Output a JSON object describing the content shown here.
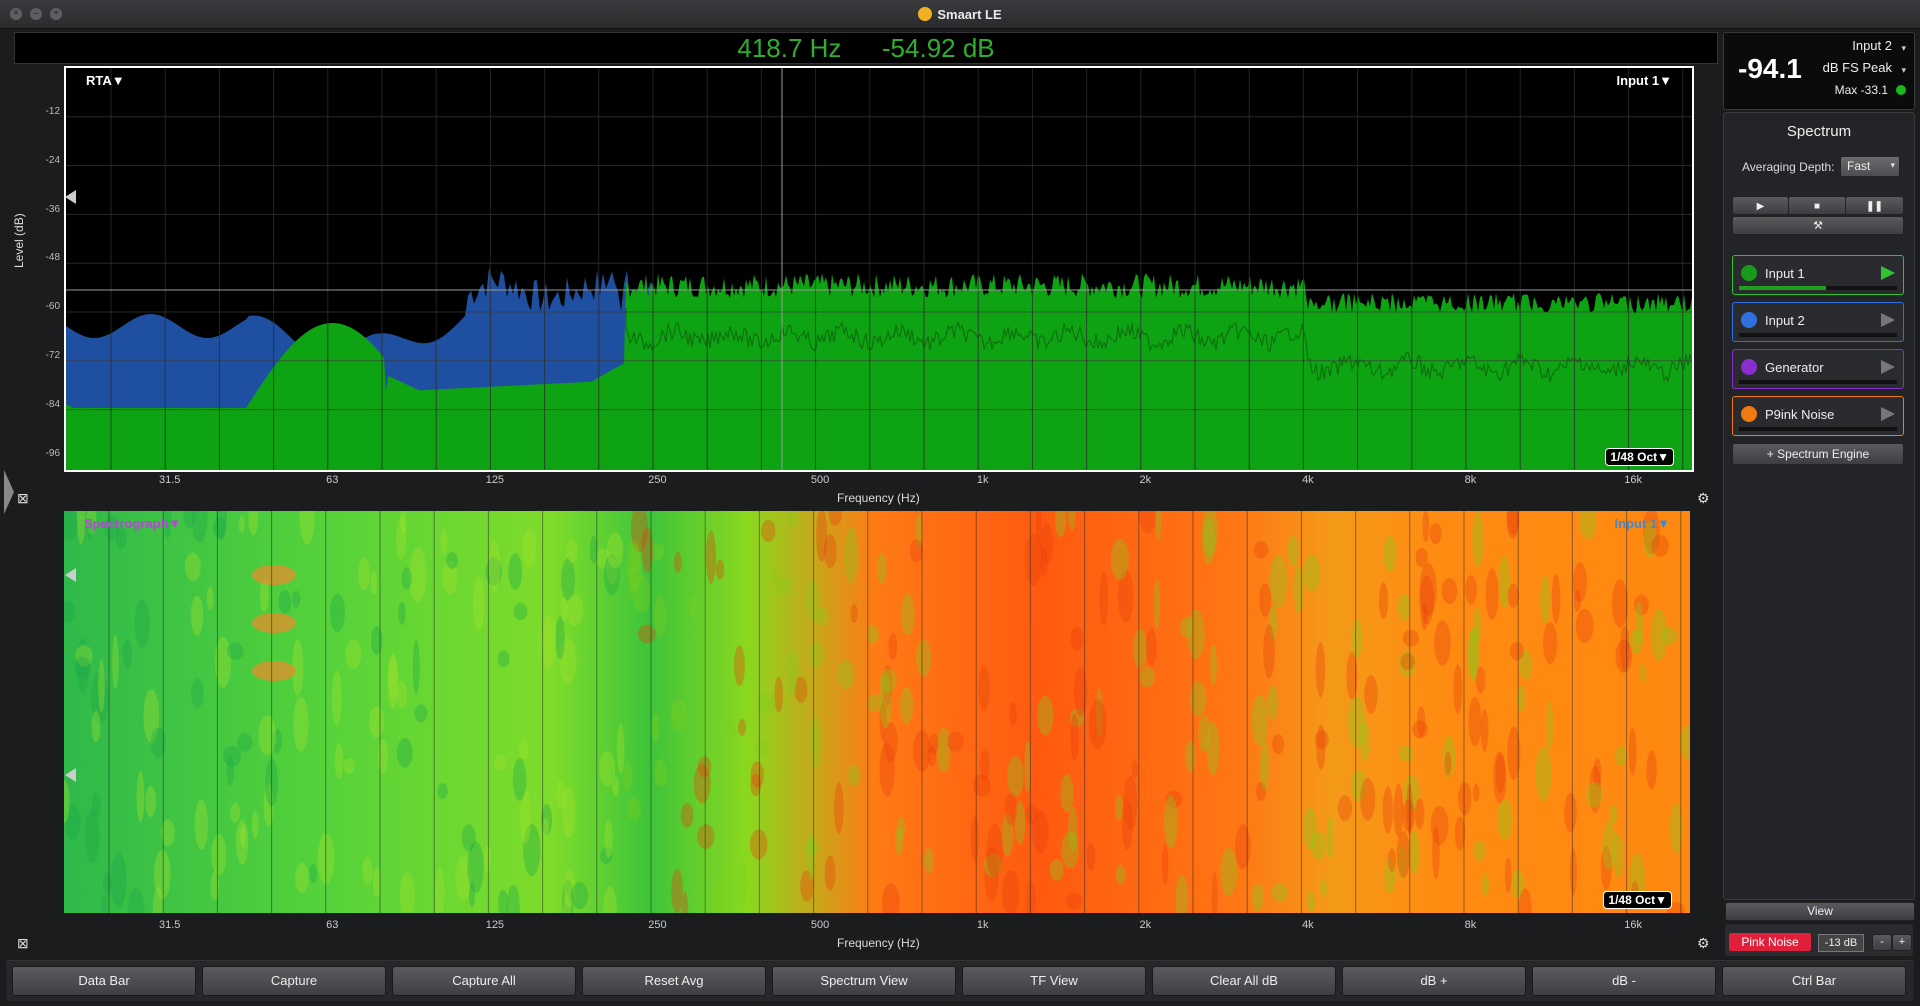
{
  "window": {
    "title": "Smaart LE"
  },
  "readout": {
    "frequency": "418.7 Hz",
    "level": "-54.92 dB"
  },
  "rta": {
    "mode_label": "RTA▼",
    "input_label": "Input 1▼",
    "resolution": "1/48 Oct▼",
    "y_axis_title": "Level (dB)",
    "y_ticks": [
      "-12",
      "-24",
      "-36",
      "-48",
      "-60",
      "-72",
      "-84",
      "-96"
    ],
    "x_axis_title": "Frequency (Hz)",
    "x_ticks": [
      "31.5",
      "63",
      "125",
      "250",
      "500",
      "1k",
      "2k",
      "4k",
      "8k",
      "16k"
    ],
    "colors": {
      "trace_blue": "#1f4fa0",
      "trace_green": "#0ea313"
    }
  },
  "spectrograph": {
    "mode_label": "Spectrograph▼",
    "input_label": "Input 1▼",
    "resolution": "1/48 Oct▼",
    "x_axis_title": "Frequency (Hz)",
    "x_ticks": [
      "31.5",
      "63",
      "125",
      "250",
      "500",
      "1k",
      "2k",
      "4k",
      "8k",
      "16k"
    ]
  },
  "meter": {
    "value": "-94.1",
    "input": "Input 2",
    "mode": "dB FS Peak",
    "max": "Max -33.1"
  },
  "spectrum_panel": {
    "title": "Spectrum",
    "averaging_label": "Averaging Depth:",
    "averaging_value": "Fast",
    "inputs": [
      {
        "label": "Input 1",
        "color": "#1a9a1a",
        "active": true
      },
      {
        "label": "Input 2",
        "color": "#2f6fe0",
        "active": false
      },
      {
        "label": "Generator",
        "color": "#8a2ed0",
        "active": false
      },
      {
        "label": "P9ink Noise",
        "color": "#f07a10",
        "active": false
      }
    ],
    "add_engine": "+ Spectrum Engine",
    "view_label": "View",
    "generator_button": "Pink Noise",
    "generator_level": "-13 dB",
    "minus": "-",
    "plus": "+"
  },
  "bottom_bar": [
    "Data Bar",
    "Capture",
    "Capture All",
    "Reset Avg",
    "Spectrum View",
    "TF View",
    "Clear All dB",
    "dB +",
    "dB -",
    "Ctrl Bar"
  ]
}
